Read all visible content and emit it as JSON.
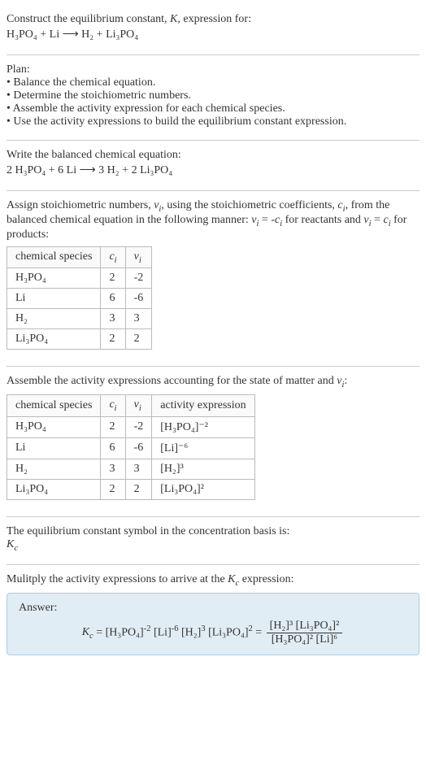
{
  "intro": {
    "line1": "Construct the equilibrium constant, K, expression for:",
    "equation": "H₃PO₄ + Li ⟶ H₂ + Li₃PO₄"
  },
  "plan": {
    "heading": "Plan:",
    "items": [
      "• Balance the chemical equation.",
      "• Determine the stoichiometric numbers.",
      "• Assemble the activity expression for each chemical species.",
      "• Use the activity expressions to build the equilibrium constant expression."
    ]
  },
  "balanced": {
    "heading": "Write the balanced chemical equation:",
    "equation": "2 H₃PO₄ + 6 Li ⟶ 3 H₂ + 2 Li₃PO₄"
  },
  "assign": {
    "text": "Assign stoichiometric numbers, νᵢ, using the stoichiometric coefficients, cᵢ, from the balanced chemical equation in the following manner: νᵢ = -cᵢ for reactants and νᵢ = cᵢ for products:",
    "headers": [
      "chemical species",
      "cᵢ",
      "νᵢ"
    ],
    "rows": [
      {
        "sp": "H₃PO₄",
        "c": "2",
        "v": "-2"
      },
      {
        "sp": "Li",
        "c": "6",
        "v": "-6"
      },
      {
        "sp": "H₂",
        "c": "3",
        "v": "3"
      },
      {
        "sp": "Li₃PO₄",
        "c": "2",
        "v": "2"
      }
    ]
  },
  "assemble": {
    "text": "Assemble the activity expressions accounting for the state of matter and νᵢ:",
    "headers": [
      "chemical species",
      "cᵢ",
      "νᵢ",
      "activity expression"
    ],
    "rows": [
      {
        "sp": "H₃PO₄",
        "c": "2",
        "v": "-2",
        "a": "[H₃PO₄]⁻²"
      },
      {
        "sp": "Li",
        "c": "6",
        "v": "-6",
        "a": "[Li]⁻⁶"
      },
      {
        "sp": "H₂",
        "c": "3",
        "v": "3",
        "a": "[H₂]³"
      },
      {
        "sp": "Li₃PO₄",
        "c": "2",
        "v": "2",
        "a": "[Li₃PO₄]²"
      }
    ]
  },
  "symbol": {
    "text": "The equilibrium constant symbol in the concentration basis is:",
    "sym": "K꜀"
  },
  "multiply": {
    "text": "Mulitply the activity expressions to arrive at the K꜀ expression:"
  },
  "answer": {
    "label": "Answer:",
    "lhs": "K꜀ = [H₃PO₄]⁻² [Li]⁻⁶ [H₂]³ [Li₃PO₄]² = ",
    "num": "[H₂]³ [Li₃PO₄]²",
    "den": "[H₃PO₄]² [Li]⁶"
  }
}
